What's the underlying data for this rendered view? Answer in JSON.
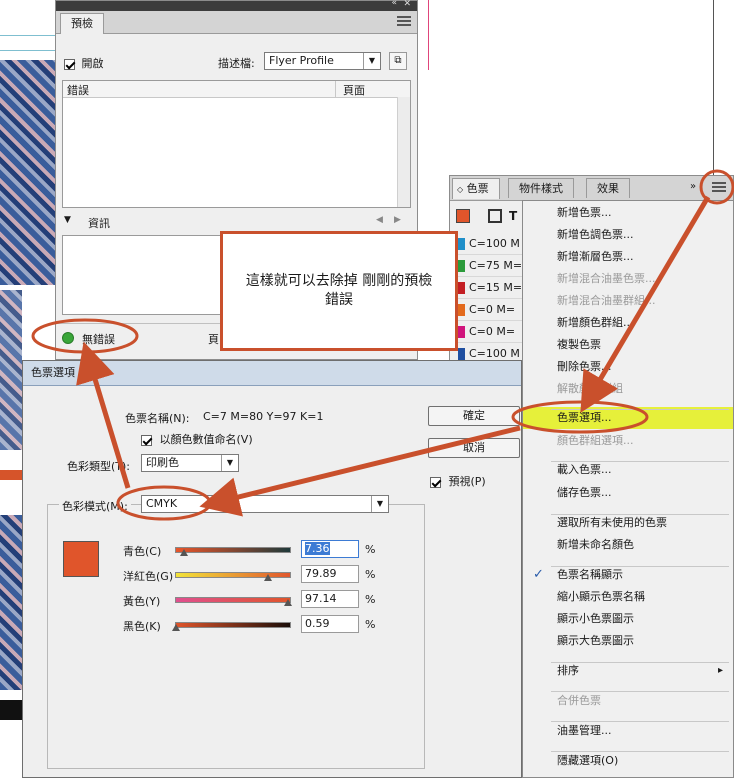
{
  "preflight": {
    "tab": "預檢",
    "on_label": "開啟",
    "profile_label": "描述檔:",
    "profile_value": "Flyer Profile",
    "col_error": "錯誤",
    "col_page": "頁面",
    "info_label": "資訊",
    "status": "無錯誤",
    "page_trunc": "頁"
  },
  "swatches_panel": {
    "tabs": [
      "色票",
      "物件樣式",
      "效果"
    ],
    "t_label": "T",
    "rows": [
      {
        "label": "C=100 M",
        "color": "#1f8fc9"
      },
      {
        "label": "C=75 M=",
        "color": "#2b9b3b"
      },
      {
        "label": "C=15 M=",
        "color": "#c31e24"
      },
      {
        "label": "C=0 M=",
        "color": "#e36a1d"
      },
      {
        "label": "C=0 M=",
        "color": "#d0147c"
      },
      {
        "label": "C=100 M",
        "color": "#1f4fa0"
      }
    ]
  },
  "menu": {
    "items": [
      {
        "label": "新增色票...",
        "disabled": false
      },
      {
        "label": "新增色調色票...",
        "disabled": false
      },
      {
        "label": "新增漸層色票...",
        "disabled": false
      },
      {
        "label": "新增混合油墨色票...",
        "disabled": true
      },
      {
        "label": "新增混合油墨群組...",
        "disabled": true
      },
      {
        "label": "新增顏色群組...",
        "disabled": false
      },
      {
        "label": "複製色票",
        "disabled": false
      },
      {
        "label": "刪除色票...",
        "disabled": false
      },
      {
        "label": "解散顏色群組",
        "disabled": true
      },
      {
        "label": "色票選項...",
        "disabled": false,
        "highlight": true
      },
      {
        "label": "顏色群組選項...",
        "disabled": true
      },
      {
        "label": "載入色票...",
        "disabled": false
      },
      {
        "label": "儲存色票...",
        "disabled": false
      },
      {
        "label": "選取所有未使用的色票",
        "disabled": false
      },
      {
        "label": "新增未命名顏色",
        "disabled": false
      },
      {
        "label": "色票名稱顯示",
        "disabled": false,
        "checked": true
      },
      {
        "label": "縮小顯示色票名稱",
        "disabled": false
      },
      {
        "label": "顯示小色票圖示",
        "disabled": false
      },
      {
        "label": "顯示大色票圖示",
        "disabled": false
      },
      {
        "label": "排序",
        "disabled": false,
        "submenu": true
      },
      {
        "label": "合併色票",
        "disabled": true
      },
      {
        "label": "油墨管理...",
        "disabled": false
      },
      {
        "label": "隱藏選項(O)",
        "disabled": false
      }
    ],
    "check_glyph": "✓",
    "submenu_glyph": "▸"
  },
  "callout": {
    "line1": "這樣就可以去除掉 剛剛的預檢",
    "line2": "錯誤"
  },
  "dialog": {
    "title": "色票選項",
    "name_label": "色票名稱(N):",
    "name_value": "C=7 M=80 Y=97 K=1",
    "name_by_value": "以顏色數值命名(V)",
    "type_label": "色彩類型(T):",
    "type_value": "印刷色",
    "mode_label": "色彩模式(M):",
    "mode_value": "CMYK",
    "ok": "確定",
    "cancel": "取消",
    "preview": "預視(P)",
    "swatch_color": "#e0552b",
    "channels": [
      {
        "label": "青色(C)",
        "value": "7.36",
        "fraction": 0.0736,
        "grad": "linear-gradient(90deg,#e9552a,#1f3a3a)"
      },
      {
        "label": "洋紅色(G)",
        "value": "79.89",
        "fraction": 0.7989,
        "grad": "linear-gradient(90deg,#f2e33a,#e0562d)"
      },
      {
        "label": "黃色(Y)",
        "value": "97.14",
        "fraction": 0.9714,
        "grad": "linear-gradient(90deg,#e0508f,#e0552b)"
      },
      {
        "label": "黑色(K)",
        "value": "0.59",
        "fraction": 0.0059,
        "grad": "linear-gradient(90deg,#e0552b,#1a0d08)"
      }
    ],
    "percent": "%"
  },
  "colors": {
    "accent_red": "#c9502c",
    "highlight_yellow": "#e6f03a",
    "status_green": "#3aa63a"
  }
}
